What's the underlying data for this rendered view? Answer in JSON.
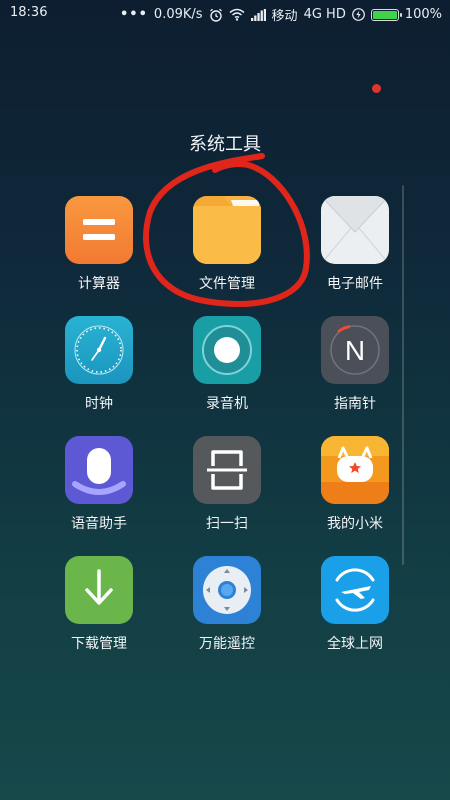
{
  "status_bar": {
    "time": "18:36",
    "more": "•••",
    "speed": "0.09K/s",
    "carrier": "移动",
    "network": "4G HD",
    "battery": "100%",
    "battery_level": 1.0,
    "icons": [
      "alarm-icon",
      "wifi-icon",
      "signal-icon",
      "charging-icon",
      "battery-icon"
    ]
  },
  "folder": {
    "title": "系统工具",
    "apps": [
      {
        "label": "计算器",
        "icon": "calculator-icon",
        "color": "#f58a3c"
      },
      {
        "label": "文件管理",
        "icon": "folder-icon",
        "color": "#f7b23f"
      },
      {
        "label": "电子邮件",
        "icon": "envelope-icon",
        "color": "#eceff1"
      },
      {
        "label": "时钟",
        "icon": "clock-icon",
        "color": "#22a6c8"
      },
      {
        "label": "录音机",
        "icon": "record-icon",
        "color": "#1a9ea6"
      },
      {
        "label": "指南针",
        "icon": "compass-icon",
        "color": "#4a4f58"
      },
      {
        "label": "语音助手",
        "icon": "voice-assistant-icon",
        "color": "#5d58d3"
      },
      {
        "label": "扫一扫",
        "icon": "scan-icon",
        "color": "#55595c"
      },
      {
        "label": "我的小米",
        "icon": "mi-bunny-icon",
        "color": "#f39a1e"
      },
      {
        "label": "下载管理",
        "icon": "download-icon",
        "color": "#6bb64a"
      },
      {
        "label": "万能遥控",
        "icon": "remote-control-icon",
        "color": "#2e82d6"
      },
      {
        "label": "全球上网",
        "icon": "plane-icon",
        "color": "#1aa0e8"
      }
    ]
  },
  "annotation_color": "#e0261b",
  "notification_dot_color": "#e2352c"
}
